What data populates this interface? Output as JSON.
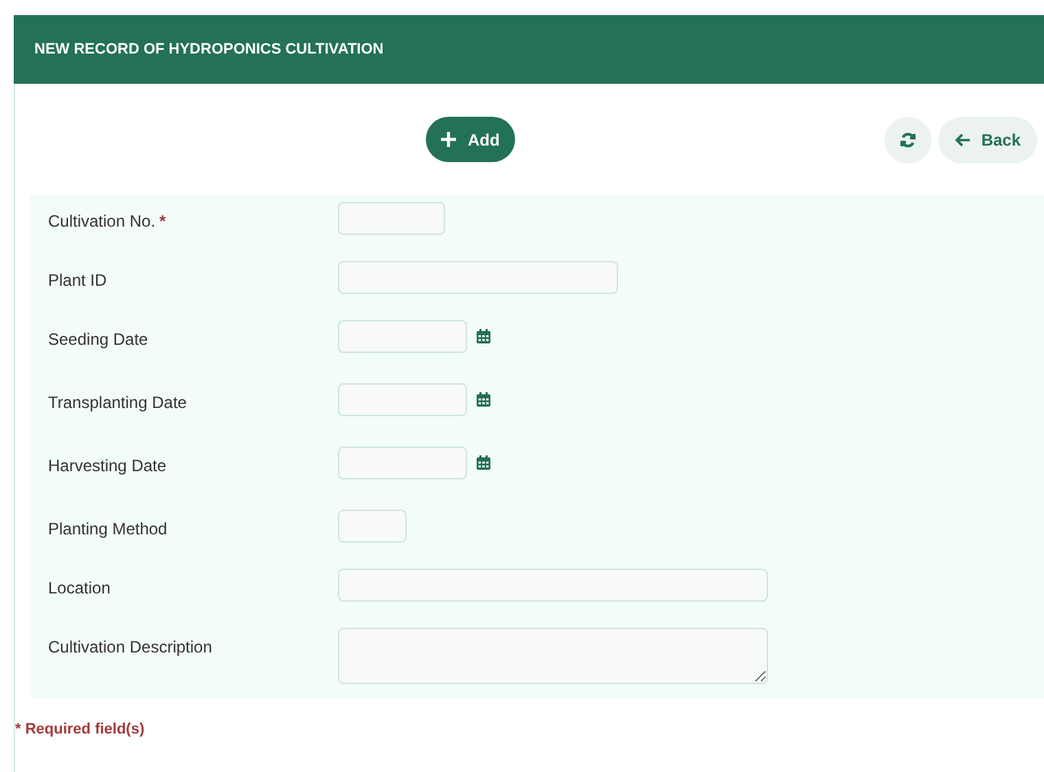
{
  "header": {
    "title": "NEW RECORD OF HYDROPONICS CULTIVATION"
  },
  "toolbar": {
    "add_button": "Add",
    "back_button": "Back"
  },
  "required_mark": "*",
  "fields": [
    {
      "label": "Cultivation No.",
      "required": true,
      "kind": "text"
    },
    {
      "label": "Plant ID",
      "required": false,
      "kind": "text"
    },
    {
      "label": "Seeding Date",
      "required": false,
      "kind": "date"
    },
    {
      "label": "Transplanting Date",
      "required": false,
      "kind": "date"
    },
    {
      "label": "Harvesting Date",
      "required": false,
      "kind": "date"
    },
    {
      "label": "Planting Method",
      "required": false,
      "kind": "text"
    },
    {
      "label": "Location",
      "required": false,
      "kind": "text"
    },
    {
      "label": "Cultivation Description",
      "required": false,
      "kind": "textarea"
    }
  ],
  "footer_note": "* Required field(s)"
}
